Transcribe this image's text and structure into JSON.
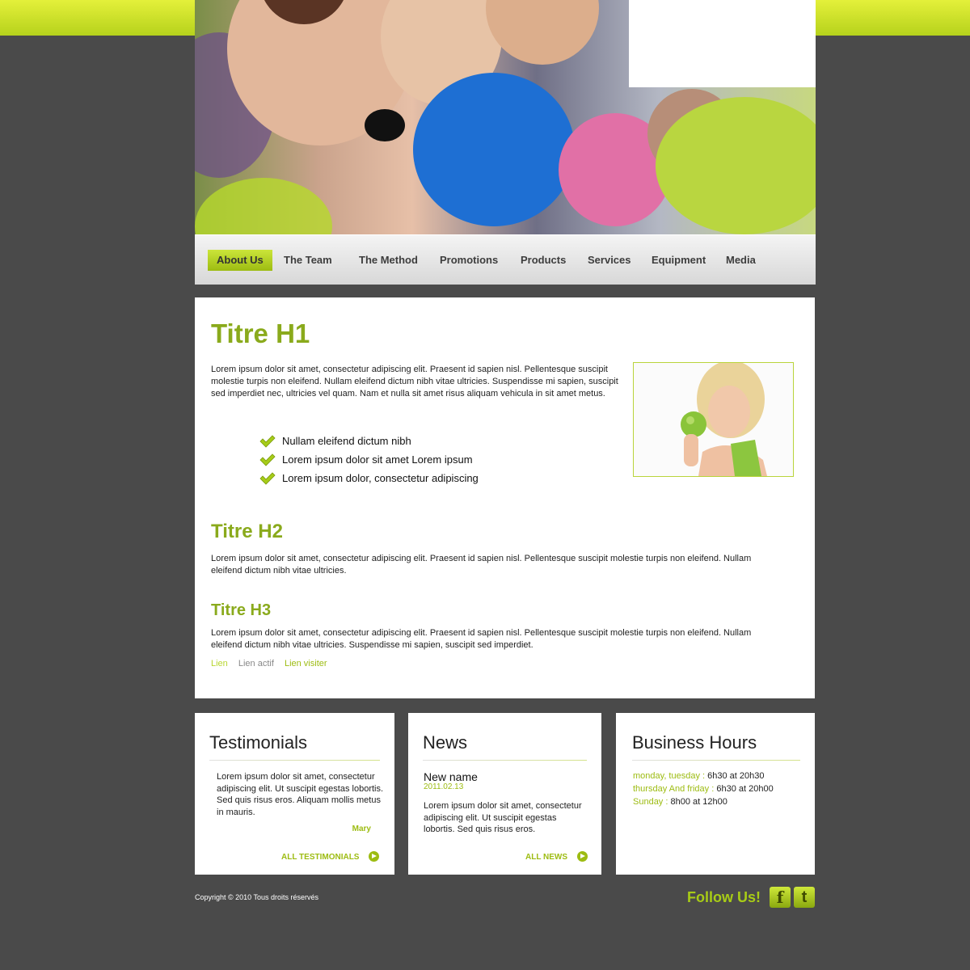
{
  "nav": {
    "items": [
      "About Us",
      "The Team",
      "The Method",
      "Promotions",
      "Products",
      "Services",
      "Equipment",
      "Media"
    ]
  },
  "content": {
    "h1": "Titre H1",
    "intro": "Lorem ipsum dolor sit amet, consectetur adipiscing elit. Praesent id sapien nisl. Pellentesque suscipit molestie turpis non eleifend. Nullam eleifend dictum nibh vitae ultricies. Suspendisse mi sapien, suscipit sed imperdiet nec, ultricies vel quam. Nam et nulla sit amet risus aliquam vehicula in sit amet metus.",
    "checklist": [
      "Nullam eleifend dictum nibh",
      "Lorem ipsum dolor sit amet Lorem ipsum",
      "Lorem ipsum dolor, consectetur adipiscing"
    ],
    "h2": "Titre H2",
    "para2": "Lorem ipsum dolor sit amet, consectetur adipiscing elit. Praesent id sapien nisl. Pellentesque suscipit molestie turpis non eleifend. Nullam eleifend dictum nibh vitae ultricies.",
    "h3": "Titre H3",
    "para3": "Lorem ipsum dolor sit amet, consectetur adipiscing elit. Praesent id sapien nisl. Pellentesque suscipit molestie turpis non eleifend. Nullam eleifend dictum nibh vitae ultricies. Suspendisse mi sapien, suscipit sed imperdiet.",
    "links": {
      "link": "Lien",
      "active": "Lien actif",
      "visited": "Lien visiter"
    }
  },
  "testimonials": {
    "title": "Testimonials",
    "text": "Lorem ipsum dolor sit amet, consectetur adipiscing elit.  Ut suscipit egestas lobortis. Sed quis risus eros. Aliquam mollis metus in mauris.",
    "author": "Mary",
    "more": "ALL TESTIMONIALS"
  },
  "news": {
    "title": "News",
    "item_title": "New name",
    "item_date": "2011.02.13",
    "text": "Lorem ipsum dolor sit amet, consectetur adipiscing elit.  Ut suscipit egestas lobortis. Sed quis risus eros.",
    "more": "ALL NEWS"
  },
  "hours": {
    "title": "Business Hours",
    "rows": [
      {
        "day": "monday, tuesday :",
        "time": "6h30 at 20h30"
      },
      {
        "day": "thursday And friday :",
        "time": "6h30 at 20h00"
      },
      {
        "day": "Sunday :",
        "time": "8h00 at 12h00"
      }
    ]
  },
  "footer": {
    "copyright": "Copyright © 2010  Tous droits réservés",
    "follow": "Follow Us!",
    "facebook_icon": "f",
    "twitter_icon": "t"
  },
  "colors": {
    "accent": "#9dbc12",
    "heading": "#8aaa1c",
    "background": "#4a4a4a"
  }
}
